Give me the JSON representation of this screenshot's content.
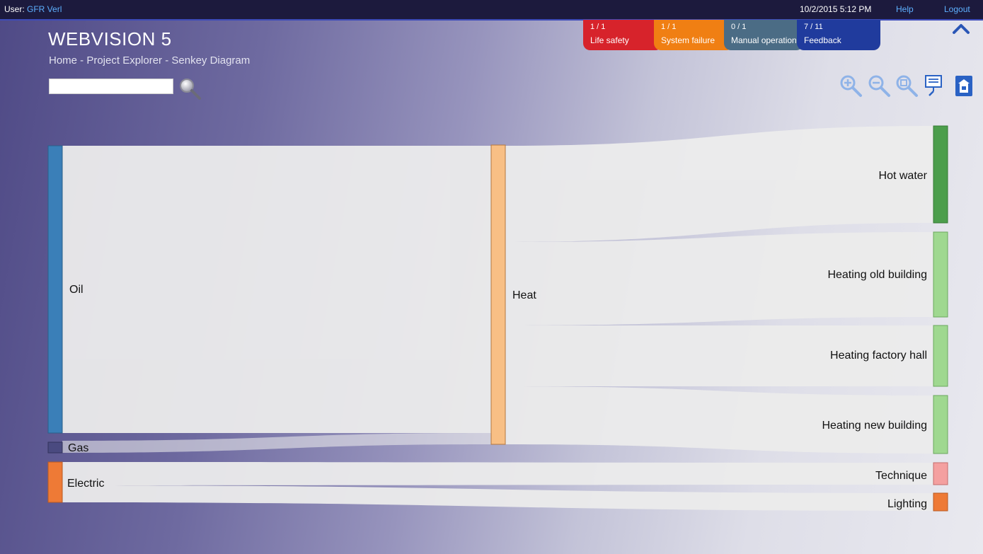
{
  "topbar": {
    "user_prefix": "User:",
    "user_name": "GFR Verl",
    "datetime": "10/2/2015 5:12 PM",
    "help": "Help",
    "logout": "Logout"
  },
  "header": {
    "title": "WEBVISION 5",
    "breadcrumb": "Home - Project Explorer - Senkey Diagram"
  },
  "search": {
    "value": "",
    "placeholder": ""
  },
  "alarms": [
    {
      "count": "1 / 1",
      "label": "Life safety",
      "color": "#d7232b"
    },
    {
      "count": "1 / 1",
      "label": "System failure",
      "color": "#f07f13"
    },
    {
      "count": "0 / 1",
      "label": "Manual operation",
      "color": "#4b6c85"
    },
    {
      "count": "7 / 11",
      "label": "Feedback",
      "color": "#203b9d"
    }
  ],
  "toolbar": {
    "icons": [
      "zoom-in-icon",
      "zoom-out-icon",
      "zoom-fit-icon",
      "presentation-icon",
      "building-icon"
    ]
  },
  "sankey": {
    "nodes": {
      "oil": "Oil",
      "gas": "Gas",
      "electric": "Electric",
      "heat": "Heat",
      "hot_water": "Hot water",
      "heating_old": "Heating old building",
      "heating_factory": "Heating factory hall",
      "heating_new": "Heating new building",
      "technique": "Technique",
      "lighting": "Lighting"
    },
    "colors": {
      "oil": "#3a7fb8",
      "gas": "#4a4a80",
      "electric": "#ee7a36",
      "heat": "#f8bf85",
      "hot_water": "#4c9e4c",
      "heating": "#9fd890",
      "technique": "#f4a0a0",
      "lighting": "#ee7a36",
      "link": "#ececec"
    }
  }
}
